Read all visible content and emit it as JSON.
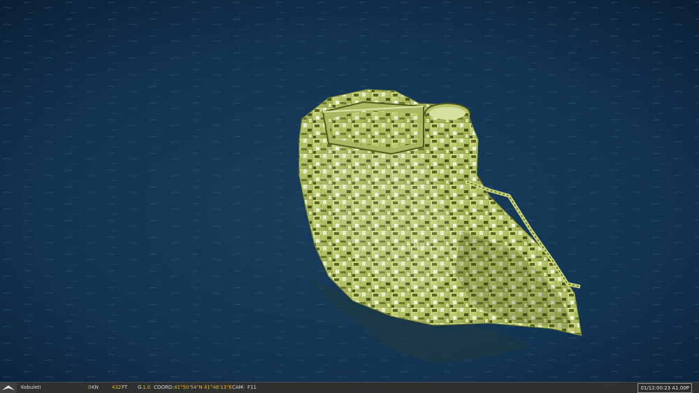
{
  "scene": {
    "sea_color": "#0f2a44",
    "island_color": "#b9c870",
    "island_dark_color": "#4f5a1c",
    "watermark_word": "ATURE"
  },
  "status_bar": {
    "logo_icon": "dcs-logo-icon",
    "location": "Kobuleti",
    "speed_value": "0",
    "speed_unit": "KN",
    "altitude_value": "432",
    "altitude_unit": "FT",
    "g_label": "G",
    "g_value": "1.0",
    "coord_label": "COORD:",
    "coord_value": "41°50'54\"N 41°46'13\"E",
    "cam_label": "CAM:",
    "cam_value": "F11",
    "time": "01/12:00:23 A1.00P",
    "accent_color": "#e6b52b"
  }
}
